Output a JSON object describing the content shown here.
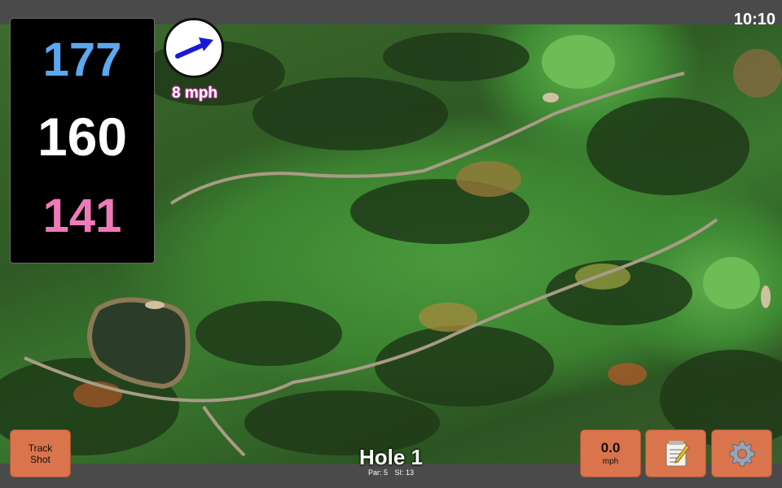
{
  "status_bar": {
    "time": "10:10"
  },
  "yardages": {
    "back": "177",
    "middle": "160",
    "front": "141"
  },
  "wind": {
    "speed_label": "8 mph",
    "direction_icon": "wind-arrow-icon"
  },
  "buttons": {
    "track_shot": {
      "line1": "Track",
      "line2": "Shot"
    },
    "wind_speed": {
      "value": "0.0",
      "unit": "mph"
    },
    "notes_icon": "notepad-icon",
    "settings_icon": "gear-icon"
  },
  "hole": {
    "title": "Hole 1",
    "par": "Par: 5",
    "si": "SI: 13"
  },
  "colors": {
    "back_yardage": "#5aa8f0",
    "middle_yardage": "#ffffff",
    "front_yardage": "#f07ab8",
    "button_bg": "#d9744c",
    "wind_text_outline": "#c23aa0"
  }
}
